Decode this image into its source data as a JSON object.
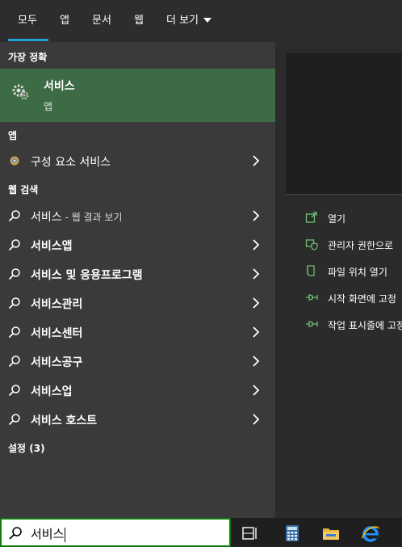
{
  "tabs": [
    {
      "label": "모두",
      "active": true
    },
    {
      "label": "앱"
    },
    {
      "label": "문서"
    },
    {
      "label": "웹"
    },
    {
      "label": "더 보기"
    }
  ],
  "best_match": {
    "header": "가장 정확",
    "title": "서비스",
    "subtitle": "앱"
  },
  "apps_section": {
    "header": "앱",
    "items": [
      {
        "label": "구성 요소 서비스"
      }
    ]
  },
  "web_section": {
    "header": "웹 검색",
    "items": [
      {
        "label": "서비스",
        "suffix": " - 웹 결과 보기"
      },
      {
        "label": "서비스앱"
      },
      {
        "label": "서비스 및 응용프로그램"
      },
      {
        "label": "서비스관리"
      },
      {
        "label": "서비스센터"
      },
      {
        "label": "서비스공구"
      },
      {
        "label": "서비스업"
      },
      {
        "label": "서비스 호스트"
      }
    ]
  },
  "settings_section": {
    "header": "설정 (3)"
  },
  "actions": [
    {
      "label": "열기",
      "icon": "open-icon"
    },
    {
      "label": "관리자 권한으로",
      "icon": "shield-icon"
    },
    {
      "label": "파일 위치 열기",
      "icon": "file-location-icon"
    },
    {
      "label": "시작 화면에 고정",
      "icon": "pin-icon"
    },
    {
      "label": "작업 표시줄에 고정",
      "icon": "pin-icon"
    }
  ],
  "search": {
    "value": "서비스"
  },
  "colors": {
    "accent": "#26a0da",
    "best_match_bg": "#3d6b45",
    "search_border": "#107c10"
  }
}
